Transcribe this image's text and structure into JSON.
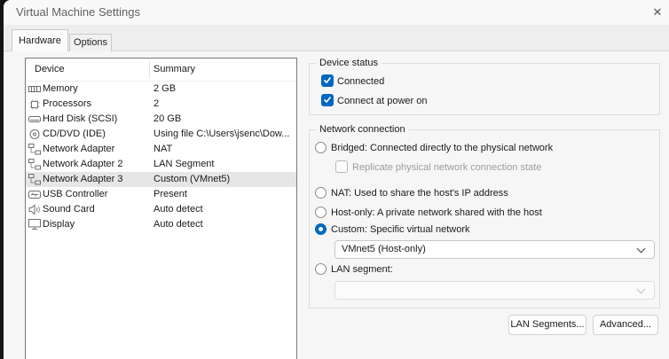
{
  "window": {
    "title": "Virtual Machine Settings",
    "close_icon": "✕"
  },
  "tabs": [
    {
      "label": "Hardware",
      "active": true
    },
    {
      "label": "Options",
      "active": false
    }
  ],
  "device_list": {
    "columns": {
      "device": "Device",
      "summary": "Summary"
    },
    "rows": [
      {
        "device": "Memory",
        "summary": "2 GB",
        "icon": "memory-icon",
        "selected": false
      },
      {
        "device": "Processors",
        "summary": "2",
        "icon": "processor-icon",
        "selected": false
      },
      {
        "device": "Hard Disk (SCSI)",
        "summary": "20 GB",
        "icon": "hard-disk-icon",
        "selected": false
      },
      {
        "device": "CD/DVD (IDE)",
        "summary": "Using file C:\\Users\\jsenc\\Dow...",
        "icon": "cd-dvd-icon",
        "selected": false
      },
      {
        "device": "Network Adapter",
        "summary": "NAT",
        "icon": "network-adapter-icon",
        "selected": false
      },
      {
        "device": "Network Adapter 2",
        "summary": "LAN Segment",
        "icon": "network-adapter-icon",
        "selected": false
      },
      {
        "device": "Network Adapter 3",
        "summary": "Custom (VMnet5)",
        "icon": "network-adapter-icon",
        "selected": true
      },
      {
        "device": "USB Controller",
        "summary": "Present",
        "icon": "usb-icon",
        "selected": false
      },
      {
        "device": "Sound Card",
        "summary": "Auto detect",
        "icon": "sound-card-icon",
        "selected": false
      },
      {
        "device": "Display",
        "summary": "Auto detect",
        "icon": "display-icon",
        "selected": false
      }
    ]
  },
  "device_status": {
    "title": "Device status",
    "checkboxes": [
      {
        "label": "Connected",
        "checked": true
      },
      {
        "label": "Connect at power on",
        "checked": true
      }
    ]
  },
  "network_connection": {
    "title": "Network connection",
    "options": [
      {
        "label": "Bridged: Connected directly to the physical network",
        "selected": false
      },
      {
        "label": "NAT: Used to share the host's IP address",
        "selected": false
      },
      {
        "label": "Host-only: A private network shared with the host",
        "selected": false
      },
      {
        "label": "Custom: Specific virtual network",
        "selected": true
      },
      {
        "label": "LAN segment:",
        "selected": false
      }
    ],
    "replicate_checkbox": {
      "label": "Replicate physical network connection state",
      "checked": false,
      "disabled": true
    },
    "custom_network_dropdown": {
      "value": "VMnet5 (Host-only)"
    },
    "lan_segment_dropdown": {
      "value": "",
      "disabled": true
    }
  },
  "buttons": [
    {
      "label": "LAN Segments..."
    },
    {
      "label": "Advanced..."
    }
  ],
  "colors": {
    "accent": "#0067c0",
    "selection_bg": "#e6e6e6",
    "dialog_bg": "#f6f6f6"
  }
}
